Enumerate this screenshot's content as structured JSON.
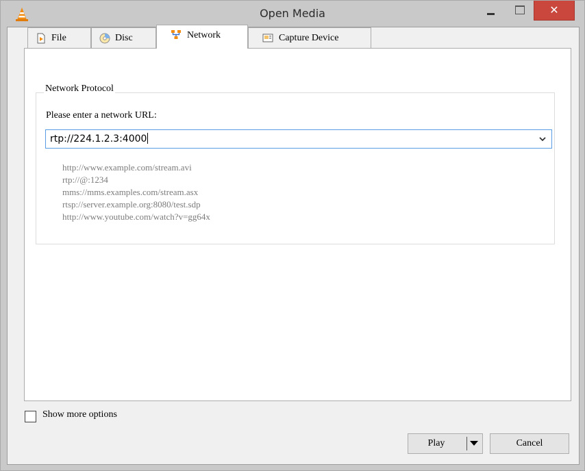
{
  "window": {
    "title": "Open Media",
    "close_glyph": "✕"
  },
  "tabs": [
    {
      "label": "File",
      "icon": "file-play-icon"
    },
    {
      "label": "Disc",
      "icon": "disc-icon"
    },
    {
      "label": "Network",
      "icon": "network-icon",
      "active": true
    },
    {
      "label": "Capture Device",
      "icon": "capture-device-icon"
    }
  ],
  "network": {
    "group_title": "Network Protocol",
    "prompt": "Please enter a network URL:",
    "url_value": "rtp://224.1.2.3:4000",
    "examples": [
      "http://www.example.com/stream.avi",
      "rtp://@:1234",
      "mms://mms.examples.com/stream.asx",
      "rtsp://server.example.org:8080/test.sdp",
      "http://www.youtube.com/watch?v=gg64x"
    ]
  },
  "options": {
    "show_more_label": "Show more options",
    "show_more_checked": false
  },
  "buttons": {
    "play": "Play",
    "cancel": "Cancel"
  },
  "colors": {
    "close": "#c9473d",
    "focus_border": "#569de5",
    "example_text": "#7c7c7c"
  }
}
